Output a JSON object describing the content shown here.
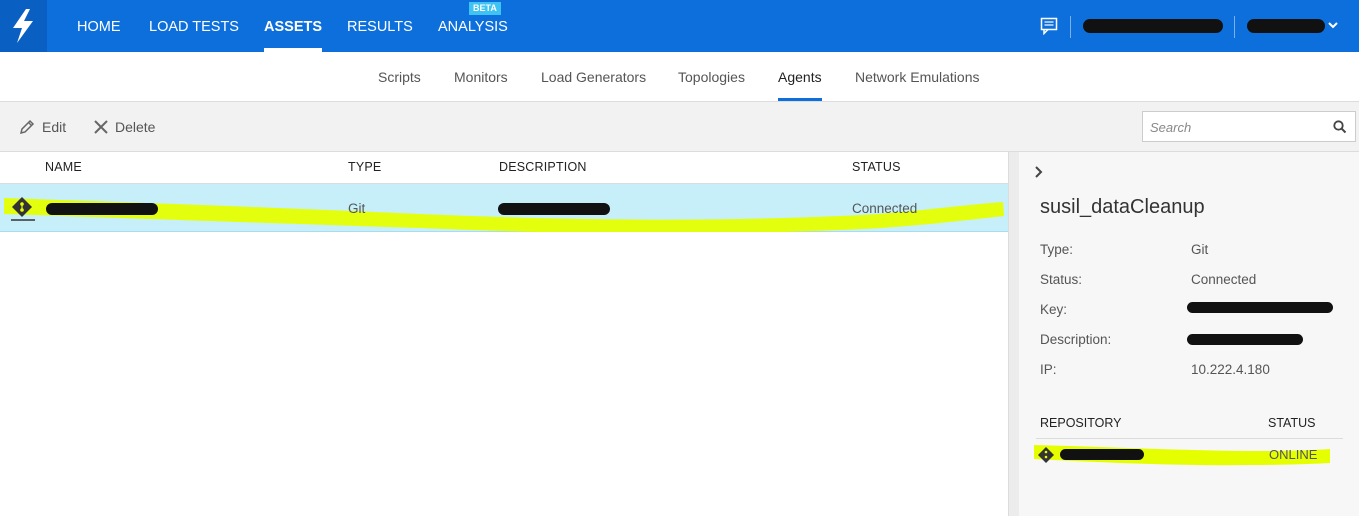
{
  "nav": {
    "items": [
      {
        "label": "HOME"
      },
      {
        "label": "LOAD TESTS"
      },
      {
        "label": "ASSETS"
      },
      {
        "label": "RESULTS"
      },
      {
        "label": "ANALYSIS"
      }
    ],
    "active": "ASSETS",
    "beta_badge": "BETA"
  },
  "subnav": {
    "items": [
      {
        "label": "Scripts"
      },
      {
        "label": "Monitors"
      },
      {
        "label": "Load Generators"
      },
      {
        "label": "Topologies"
      },
      {
        "label": "Agents"
      },
      {
        "label": "Network Emulations"
      }
    ],
    "active": "Agents"
  },
  "toolbar": {
    "edit_label": "Edit",
    "delete_label": "Delete",
    "search_placeholder": "Search"
  },
  "table": {
    "columns": [
      "NAME",
      "TYPE",
      "DESCRIPTION",
      "STATUS"
    ],
    "rows": [
      {
        "name": "[redacted]",
        "type": "Git",
        "description": "[redacted]",
        "status": "Connected",
        "icon": "git-icon",
        "selected": true
      }
    ]
  },
  "details": {
    "title": "susil_dataCleanup",
    "fields": [
      {
        "key": "Type:",
        "value": "Git"
      },
      {
        "key": "Status:",
        "value": "Connected"
      },
      {
        "key": "Key:",
        "value": "[redacted]"
      },
      {
        "key": "Description:",
        "value": "[redacted]"
      },
      {
        "key": "IP:",
        "value": "10.222.4.180"
      }
    ],
    "repo_header": "REPOSITORY",
    "repo_status_header": "STATUS",
    "repo_status": "ONLINE"
  },
  "colors": {
    "topbar": "#0d6fdc",
    "selected_row": "#c7effa",
    "highlight": "#e5ff00"
  }
}
